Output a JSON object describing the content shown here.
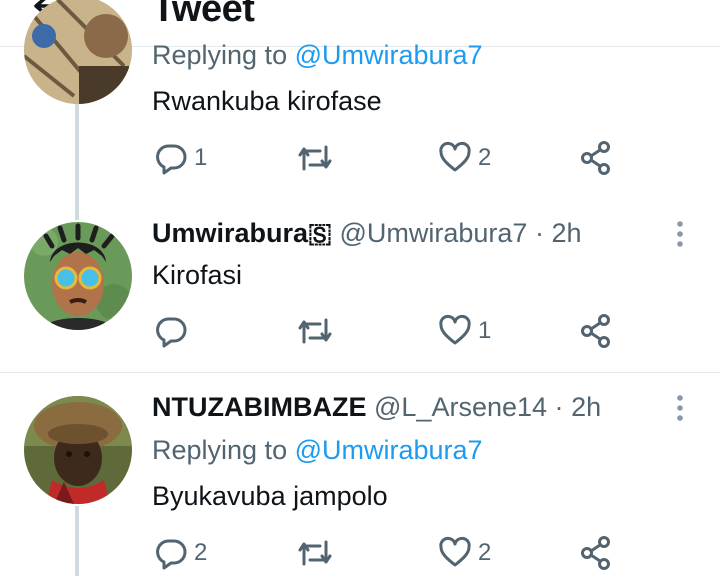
{
  "header": {
    "title": "Tweet"
  },
  "tweets": [
    {
      "reply_prefix": "Replying to",
      "reply_to": "@Umwirabura7",
      "text": "Rwankuba kirofase",
      "counts": {
        "replies": "1",
        "retweets": "",
        "likes": "2"
      }
    },
    {
      "display_name": "Umwirabura🇸",
      "handle": "@Umwirabura7",
      "separator": "·",
      "time": "2h",
      "text": "Kirofasi",
      "counts": {
        "replies": "",
        "retweets": "",
        "likes": "1"
      }
    },
    {
      "display_name": "NTUZABIMBAZE",
      "handle": "@L_Arsene14",
      "separator": "·",
      "time": "2h",
      "reply_prefix": "Replying to",
      "reply_to": "@Umwirabura7",
      "text": "Byukavuba jampolo",
      "counts": {
        "replies": "2",
        "retweets": "",
        "likes": "2"
      }
    }
  ],
  "colors": {
    "accent": "#1d9bf0",
    "secondary_text": "#536471",
    "thread_line": "#cfd9de"
  }
}
